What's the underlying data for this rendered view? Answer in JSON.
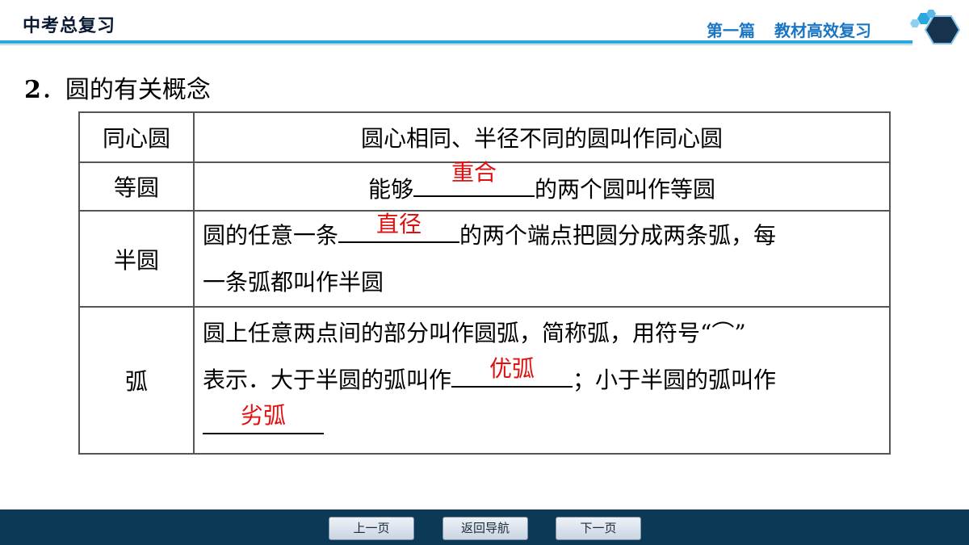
{
  "header": {
    "left_title": "中考总复习",
    "part": "第一篇",
    "section": "教材高效复习"
  },
  "section": {
    "number": "2",
    "sep": "．",
    "title": "圆的有关概念"
  },
  "table": {
    "rows": [
      {
        "term": "同心圆",
        "text": "圆心相同、半径不同的圆叫作同心圆"
      },
      {
        "term": "等圆",
        "pre": "能够",
        "answer": "重合",
        "post": "的两个圆叫作等圆"
      },
      {
        "term": "半圆",
        "pre": "圆的任意一条",
        "answer": "直径",
        "post": "的两个端点把圆分成两条弧，每",
        "line2": "一条弧都叫作半圆"
      },
      {
        "term": "弧",
        "line1": "圆上任意两点间的部分叫作圆弧，简称弧，用符号“⌒”",
        "pre": "表示．大于半圆的弧叫作",
        "answer1": "优弧",
        "mid": "；小于半圆的弧叫作",
        "answer2": "劣弧"
      }
    ]
  },
  "footer": {
    "prev": "上一页",
    "back": "返回导航",
    "next": "下一页"
  },
  "colors": {
    "accent": "#2aa7e0",
    "answer": "#e01010",
    "footer_bg": "#0c3a56"
  }
}
